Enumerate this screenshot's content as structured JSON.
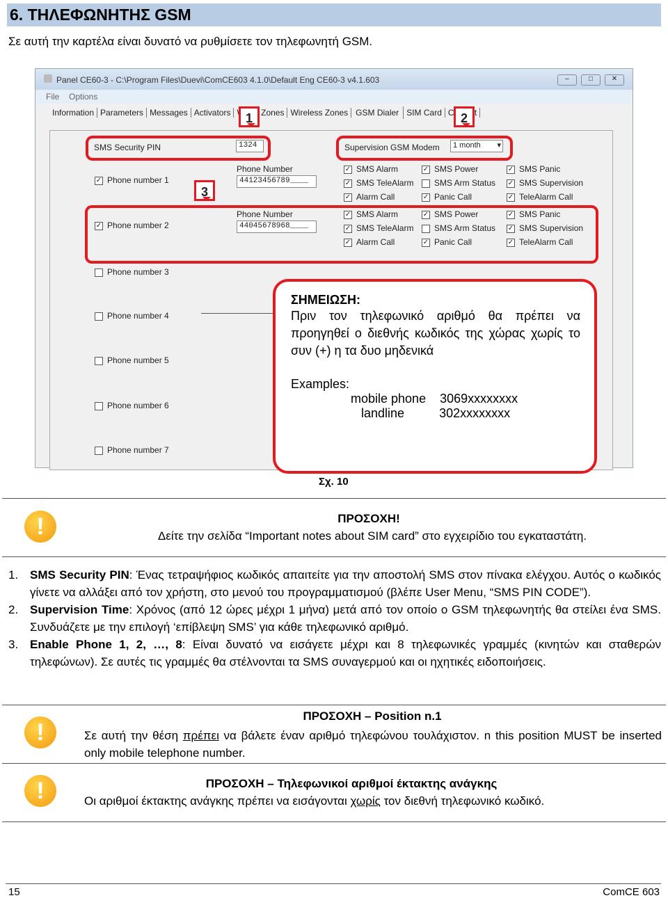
{
  "header": {
    "title": "6. ΤΗΛΕΦΩΝΗΤΗΣ GSM"
  },
  "intro": "Σε αυτή την καρτέλα  είναι δυνατό να ρυθμίσετε τον τηλεφωνητή GSM.",
  "window": {
    "title": "Panel CE60-3 - C:\\Program Files\\Duevi\\ComCE603 4.1.0\\Default Eng CE60-3 v4.1.603",
    "menu": [
      "File",
      "Options"
    ],
    "tabs": [
      "Information",
      "Parameters",
      "Messages",
      "Activators",
      "Wired Zones",
      "Wireless Zones",
      "GSM Dialer",
      "SIM Card",
      "Contact"
    ],
    "pin_label": "SMS Security PIN",
    "pin_value": "1324",
    "supervision_label": "Supervision GSM Modem",
    "supervision_value": "1 month",
    "phone_number_label": "Phone Number",
    "phones": [
      {
        "label": "Phone number 1",
        "checked": true,
        "number": "44123456789____"
      },
      {
        "label": "Phone number 2",
        "checked": true,
        "number": "44045678968____"
      },
      {
        "label": "Phone number 3",
        "checked": false
      },
      {
        "label": "Phone number 4",
        "checked": false
      },
      {
        "label": "Phone number 5",
        "checked": false
      },
      {
        "label": "Phone number 6",
        "checked": false
      },
      {
        "label": "Phone number 7",
        "checked": false
      }
    ],
    "options": [
      {
        "label": "SMS Alarm",
        "checked": true
      },
      {
        "label": "SMS Power",
        "checked": true
      },
      {
        "label": "SMS Panic",
        "checked": true
      },
      {
        "label": "SMS TeleAlarm",
        "checked": true
      },
      {
        "label": "SMS Arm Status",
        "checked": false
      },
      {
        "label": "SMS Supervision",
        "checked": true
      },
      {
        "label": "Alarm Call",
        "checked": true
      },
      {
        "label": "Panic Call",
        "checked": true
      },
      {
        "label": "TeleAlarm Call",
        "checked": true
      }
    ],
    "badges": [
      "1",
      "2",
      "3"
    ]
  },
  "note": {
    "title": "ΣΗΜΕΙΩΣΗ:",
    "text": "Πριν τον τηλεφωνικό αριθμό θα πρέπει να προηγηθεί ο διεθνής κωδικός της χώρας χωρίς το συν (+) η τα δυο μηδενικά",
    "examples": "Examples:",
    "mobile_label": "mobile phone",
    "mobile_value": "3069xxxxxxxx",
    "landline_label": "landline",
    "landline_value": "302xxxxxxxx"
  },
  "caption": "Σχ. 10",
  "warning1": {
    "title": "ΠΡΟΣΟΧΗ!",
    "text": "Δείτε την σελίδα “Important notes about SIM card” στο εγχειρίδιο του εγκαταστάτη."
  },
  "list": [
    {
      "num": "1.",
      "term": "SMS Security PIN",
      "text": ": Ένας τετραψήφιος κωδικός απαιτείτε για την αποστολή SMS στον πίνακα ελέγχου. Αυτός ο κωδικός γίνετε να αλλάξει από τον χρήστη, στο μενού του προγραμματισμού (βλέπε User Menu, “SMS PIN CODE”)."
    },
    {
      "num": "2.",
      "term": "Supervision Time",
      "text": ": Χρόνος (από 12 ώρες μέχρι 1 μήνα) μετά από τον οποίο ο GSM τηλεφωνητής θα στείλει ένα SMS. Συνδυάζετε με την επιλογή ‘επίβλεψη SMS’ για κάθε τηλεφωνικό αριθμό."
    },
    {
      "num": "3.",
      "term": "Enable Phone 1, 2, …, 8",
      "text": ": Είναι δυνατό να εισάγετε μέχρι και 8 τηλεφωνικές γραμμές (κινητών και σταθερών τηλεφώνων). Σε αυτές τις γραμμές θα στέλνονται τα SMS συναγερμού και οι ηχητικές ειδοποιήσεις."
    }
  ],
  "warning2": {
    "title": "ΠΡΟΣΟΧΗ – Position n.1",
    "pre": "Σε αυτή την θέση ",
    "underlined": "πρέπει",
    "post": " να βάλετε έναν αριθμό τηλεφώνου τουλάχιστον. n this position MUST be inserted only mobile telephone number."
  },
  "warning3": {
    "title": "ΠΡΟΣΟΧΗ – Τηλεφωνικοί αριθμοί έκτακτης ανάγκης",
    "pre": "Οι αριθμοί έκτακτης ανάγκης πρέπει να εισάγονται ",
    "underlined": "χωρίς",
    "post": " τον διεθνή τηλεφωνικό κωδικό."
  },
  "footer": {
    "page": "15",
    "product": "ComCE 603"
  }
}
